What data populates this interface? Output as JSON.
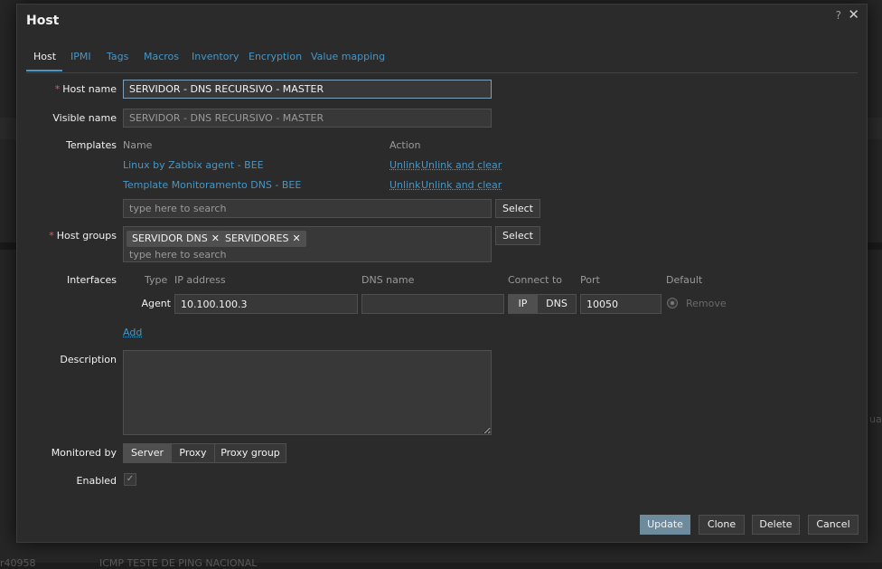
{
  "background": {
    "bottom_left_text": "r40958",
    "bottom_middle_text": "ICMP TESTE DE PING NACIONAL",
    "right_edge_text": "ua"
  },
  "dialog": {
    "title": "Host",
    "help": "?",
    "close": "✕"
  },
  "tabs": [
    {
      "label": "Host",
      "active": true
    },
    {
      "label": "IPMI"
    },
    {
      "label": "Tags"
    },
    {
      "label": "Macros"
    },
    {
      "label": "Inventory"
    },
    {
      "label": "Encryption"
    },
    {
      "label": "Value mapping"
    }
  ],
  "form": {
    "host_name": {
      "label": "Host name",
      "value": "SERVIDOR - DNS RECURSIVO - MASTER"
    },
    "visible_name": {
      "label": "Visible name",
      "placeholder": "SERVIDOR - DNS RECURSIVO - MASTER"
    },
    "templates": {
      "label": "Templates",
      "col_name": "Name",
      "col_action": "Action",
      "rows": [
        {
          "name": "Linux by Zabbix agent - BEE",
          "unlink": "Unlink",
          "unlink_clear": "Unlink and clear"
        },
        {
          "name": "Template Monitoramento DNS - BEE",
          "unlink": "Unlink",
          "unlink_clear": "Unlink and clear"
        }
      ],
      "search_placeholder": "type here to search",
      "select_label": "Select"
    },
    "host_groups": {
      "label": "Host groups",
      "chips": [
        "SERVIDOR DNS",
        "SERVIDORES"
      ],
      "chip_remove": "✕",
      "search_placeholder": "type here to search",
      "select_label": "Select"
    },
    "interfaces": {
      "label": "Interfaces",
      "headers": {
        "type": "Type",
        "ip": "IP address",
        "dns": "DNS name",
        "connect": "Connect to",
        "port": "Port",
        "default": "Default"
      },
      "row": {
        "type": "Agent",
        "ip": "10.100.100.3",
        "dns": "",
        "connect_ip": "IP",
        "connect_dns": "DNS",
        "port": "10050",
        "remove": "Remove"
      },
      "add_label": "Add"
    },
    "description": {
      "label": "Description",
      "value": ""
    },
    "monitored_by": {
      "label": "Monitored by",
      "options": [
        "Server",
        "Proxy",
        "Proxy group"
      ],
      "selected": "Server"
    },
    "enabled": {
      "label": "Enabled",
      "checked": true,
      "check_glyph": "✓"
    }
  },
  "footer": {
    "update": "Update",
    "clone": "Clone",
    "delete": "Delete",
    "cancel": "Cancel"
  },
  "colors": {
    "link": "#4796c4",
    "required": "#e45959",
    "primary_button": "#6e8a9d"
  }
}
